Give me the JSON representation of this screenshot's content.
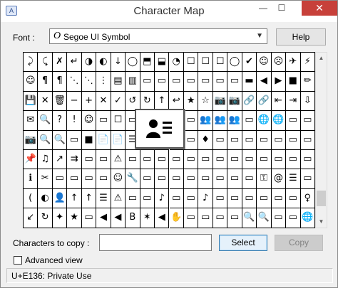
{
  "window": {
    "title": "Character Map"
  },
  "titlebar_buttons": {
    "minimize": "—",
    "maximize": "☐",
    "close": "✕"
  },
  "font": {
    "label": "Font :",
    "selected": "Segoe UI Symbol",
    "type_glyph": "O"
  },
  "help_button": "Help",
  "grid": {
    "cols": 20,
    "rows": [
      [
        "⤸",
        "⤹",
        "✗",
        "↵",
        "◑",
        "◐",
        "↓",
        "◯",
        "⬒",
        "⬓",
        "◔",
        "☐",
        "☐",
        "☐",
        "◯",
        "✔",
        "☺",
        "☹",
        "✈",
        "⚡"
      ],
      [
        "☺",
        "¶",
        "¶",
        "⋱",
        "⋱",
        "⋮",
        "▤",
        "▥",
        "▭",
        "▭",
        "▭",
        "▭",
        "▭",
        "▭",
        "▭",
        "▬",
        "◀",
        "▶",
        "■",
        "✏"
      ],
      [
        "💾",
        "✕",
        "🗑",
        "−",
        "+",
        "✕",
        "✓",
        "↺",
        "↻",
        "↑",
        "↩",
        "★",
        "☆",
        "📷",
        "📷",
        "🔗",
        "🔗",
        "⇤",
        "⇥",
        "⇩"
      ],
      [
        "✉",
        "🔍",
        "?",
        "!",
        "☺",
        "▭",
        "☐",
        "▭",
        "▭",
        "▭",
        "▭",
        "▭",
        "👥",
        "👥",
        "👥",
        "▭",
        "🌐",
        "🌐",
        "▭",
        "▭"
      ],
      [
        "📷",
        "🔍",
        "🔍",
        "▭",
        "■",
        "📄",
        "📄",
        "☰",
        "▭",
        "👤",
        "▭",
        "▭",
        "♦",
        "▭",
        "▭",
        "▭",
        "▭",
        "▭",
        "▭",
        "▭"
      ],
      [
        "📌",
        "♫",
        "↗",
        "⇉",
        "▭",
        "▭",
        "⚠",
        "▭",
        "▭",
        "▭",
        "▭",
        "▭",
        "▭",
        "▭",
        "▭",
        "▭",
        "▭",
        "▭",
        "▭",
        "▭"
      ],
      [
        "ℹ",
        "✂",
        "▭",
        "▭",
        "▭",
        "▭",
        "☺",
        "🔧",
        "▭",
        "▭",
        "▭",
        "▭",
        "▭",
        "▭",
        "▭",
        "▭",
        "⚿",
        "@",
        "☰",
        "▭"
      ],
      [
        "(",
        "◐",
        "👤",
        "↑",
        "↑",
        "☰",
        "⚠",
        "▭",
        "▭",
        "♪",
        "▭",
        "▭",
        "♪",
        "▭",
        "▭",
        "▭",
        "▭",
        "▭",
        "▭",
        "♀"
      ],
      [
        "↙",
        "↻",
        "✦",
        "★",
        "▭",
        "◀",
        "◀",
        "B",
        "✶",
        "◀",
        "✋",
        "▭",
        "▭",
        "▭",
        "▭",
        "🔍",
        "🔍",
        "▭",
        "▭",
        "🌐"
      ]
    ]
  },
  "magnifier": {
    "glyph": "contact-card"
  },
  "copy_label": "Characters to copy :",
  "copy_value": "",
  "select_button": "Select",
  "copy_button": "Copy",
  "advanced_view": {
    "label": "Advanced view",
    "checked": false
  },
  "status": "U+E136: Private Use"
}
